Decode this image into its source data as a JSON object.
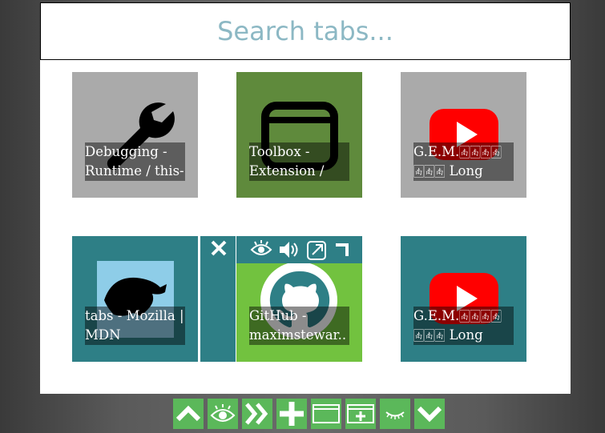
{
  "search": {
    "placeholder": "Search tabs..."
  },
  "tabs": [
    {
      "title": "Debugging - Runtime / this-",
      "bg": "#aaaaaa",
      "icon": "wrench-icon"
    },
    {
      "title": "Toolbox - Extension / Tab",
      "bg": "#5f8a3c",
      "icon": "window-icon"
    },
    {
      "title": "G.E.M.🀁🀁🀁🀁 🀁🀁🀁 Long",
      "bg": "#aaaaaa",
      "icon": "youtube-icon"
    },
    {
      "title": "tabs - Mozilla | MDN",
      "bg": "#2e7f86",
      "icon": "mdn-dino-icon"
    },
    {
      "title": "GitHub - maximstewar...",
      "bg": "#72c23f",
      "icon": "github-icon"
    },
    {
      "title": "G.E.M.🀁🀁🀁🀁 🀁🀁🀁 Long",
      "bg": "#2e7f86",
      "icon": "youtube-icon"
    }
  ],
  "hover_toolbar": {
    "actions": [
      "close-icon",
      "eye-icon",
      "speaker-icon",
      "popout-icon",
      "corner-icon"
    ]
  },
  "bottom_bar": {
    "buttons": [
      "chevron-up-icon",
      "eye-icon",
      "double-chevron-right-icon",
      "plus-icon",
      "window-icon",
      "new-window-icon",
      "closed-eye-icon",
      "chevron-down-icon"
    ],
    "color": "#5bb85a"
  }
}
